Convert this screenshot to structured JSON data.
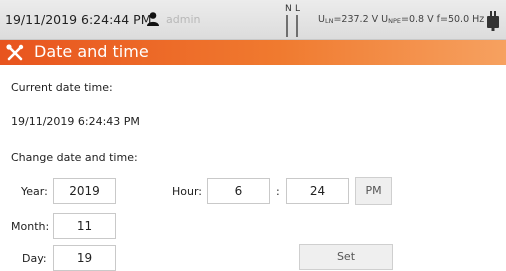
{
  "status_bar": {
    "datetime": "19/11/2019 6:24:44 PM",
    "user": "admin",
    "nl_n": "N",
    "nl_l": "L",
    "uln_label": "U",
    "uln_sub": "LN",
    "uln_value": "=237.2 V",
    "unpe_label": "U",
    "unpe_sub": "NPE",
    "unpe_value": "=0.8 V",
    "freq": "f=50.0 Hz"
  },
  "title": "Date and time",
  "current_label": "Current date time:",
  "current_value": "19/11/2019 6:24:43 PM",
  "change_label": "Change date and time:",
  "fields": {
    "year_label": "Year:",
    "year": "2019",
    "month_label": "Month:",
    "month": "11",
    "day_label": "Day:",
    "day": "19",
    "hour_label": "Hour:",
    "hour": "6",
    "colon": ":",
    "minute": "24",
    "ampm": "PM"
  },
  "set_label": "Set",
  "colors": {
    "accent": "#e8541e",
    "accent_light": "#f6a160"
  }
}
